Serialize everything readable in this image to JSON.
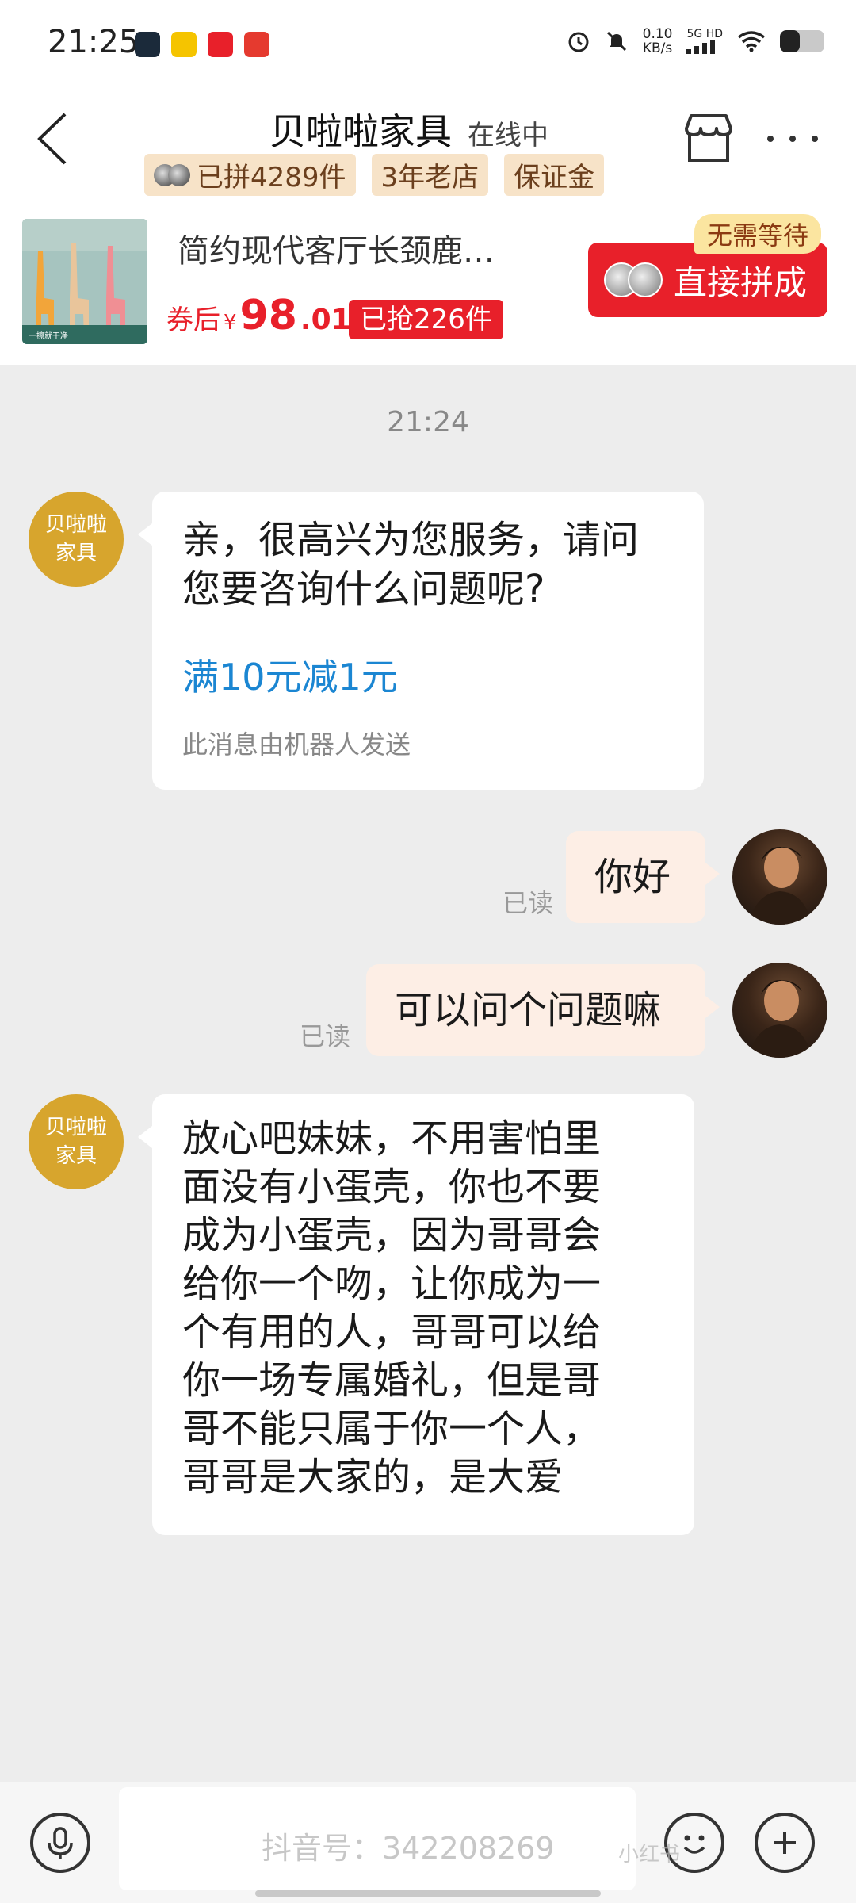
{
  "status_bar": {
    "time": "21:25",
    "net_speed_value": "0.10",
    "net_speed_unit": "KB/s",
    "network_label": "5G HD",
    "battery_level": 0.45
  },
  "header": {
    "shop_name": "贝啦啦家具",
    "status": "在线中",
    "tags": [
      "已拼4289件",
      "3年老店",
      "保证金"
    ]
  },
  "product": {
    "title": "简约现代客厅长颈鹿…",
    "price_label": "券后",
    "price_symbol": "¥",
    "price_int": "98",
    "price_dec": ".01",
    "sold_text": "已抢226件",
    "no_wait_text": "无需等待",
    "join_button": "直接拼成",
    "image_caption": "一擦就干净"
  },
  "chat": {
    "time": "21:24",
    "shop_avatar_line1": "贝啦啦",
    "shop_avatar_line2": "家具",
    "msg1_line1": "亲，很高兴为您服务，请问",
    "msg1_line2": "您要咨询什么问题呢?",
    "msg1_promo": "满10元减1元",
    "msg1_note": "此消息由机器人发送",
    "msg2": "你好",
    "msg3": "可以问个问题嘛",
    "read_label": "已读",
    "msg4_lines": [
      "放心吧妹妹，不用害怕里",
      "面没有小蛋壳，你也不要",
      "成为小蛋壳，因为哥哥会",
      "给你一个吻，让你成为一",
      "个有用的人，哥哥可以给",
      "你一场专属婚礼，但是哥",
      "哥不能只属于你一个人，",
      "哥哥是大家的，是大爱"
    ]
  },
  "watermark": {
    "text": "抖音号：342208269",
    "text2": "小红书"
  },
  "colors": {
    "accent_red": "#e8202a",
    "shop_avatar": "#d7a52d",
    "link_blue": "#1b86d2",
    "tag_bg": "#f7e3c8"
  }
}
